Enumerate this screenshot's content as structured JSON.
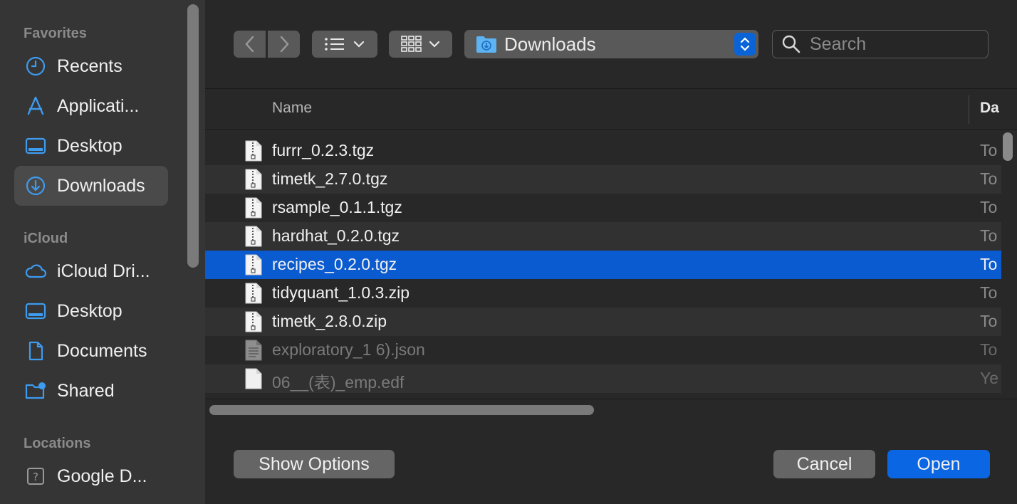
{
  "sidebar": {
    "sections": [
      {
        "title": "Favorites"
      },
      {
        "title": "iCloud"
      },
      {
        "title": "Locations"
      }
    ],
    "items": [
      {
        "label": "Recents",
        "icon": "clock-icon"
      },
      {
        "label": "Applicati...",
        "icon": "applications-icon"
      },
      {
        "label": "Desktop",
        "icon": "desktop-icon"
      },
      {
        "label": "Downloads",
        "icon": "downloads-icon"
      },
      {
        "label": "iCloud Dri...",
        "icon": "cloud-icon"
      },
      {
        "label": "Desktop",
        "icon": "desktop-icon"
      },
      {
        "label": "Documents",
        "icon": "document-icon"
      },
      {
        "label": "Shared",
        "icon": "shared-folder-icon"
      },
      {
        "label": "Google D...",
        "icon": "drive-question-icon"
      }
    ]
  },
  "toolbar": {
    "location": "Downloads",
    "search_placeholder": "Search"
  },
  "columns": {
    "name": "Name",
    "date": "Da"
  },
  "files": [
    {
      "name": "furrr_0.2.3.tgz",
      "date": "To"
    },
    {
      "name": "timetk_2.7.0.tgz",
      "date": "To"
    },
    {
      "name": "rsample_0.1.1.tgz",
      "date": "To"
    },
    {
      "name": "hardhat_0.2.0.tgz",
      "date": "To"
    },
    {
      "name": "recipes_0.2.0.tgz",
      "date": "To"
    },
    {
      "name": "tidyquant_1.0.3.zip",
      "date": "To"
    },
    {
      "name": "timetk_2.8.0.zip",
      "date": "To"
    },
    {
      "name": "exploratory_1 6).json",
      "date": "To"
    },
    {
      "name": "06__(表)_emp.edf",
      "date": "Ye"
    }
  ],
  "footer": {
    "options_label": "Show Options",
    "cancel_label": "Cancel",
    "open_label": "Open"
  },
  "colors": {
    "accent": "#0a64d8",
    "selection": "#0a5bd0",
    "icon_blue": "#3d9bf0"
  }
}
